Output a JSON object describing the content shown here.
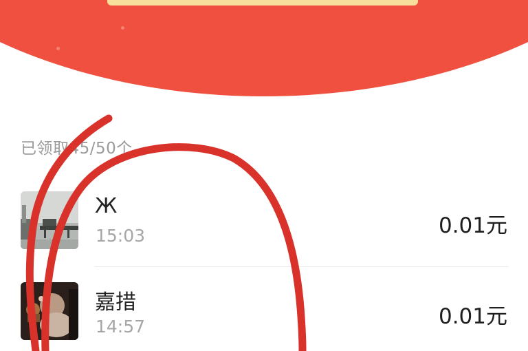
{
  "header": {
    "background_color": "#f0503f",
    "button_color": "#f7df9c"
  },
  "summary": {
    "text": "已领取45/50个"
  },
  "records": [
    {
      "name": "Ж",
      "time": "15:03",
      "amount": "0.01元",
      "avatar": "lake-pier-photo"
    },
    {
      "name": "嘉措",
      "time": "14:57",
      "amount": "0.01元",
      "avatar": "dim-room-photo"
    }
  ],
  "annotation": {
    "stroke_color": "#d8322b"
  }
}
